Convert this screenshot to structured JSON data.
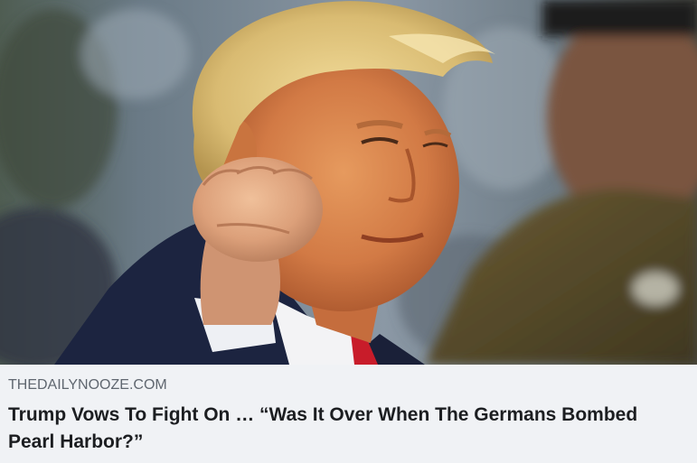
{
  "link_preview": {
    "image_alt": "Photo of a man in a dark suit raising a clenched fist",
    "domain": "THEDAILYNOOZE.COM",
    "headline": "Trump Vows To Fight On … “Was It Over When The Germans Bombed Pearl Harbor?”"
  },
  "colors": {
    "caption_background": "#f0f2f5",
    "domain_text": "#606770",
    "headline_text": "#1c1e21"
  }
}
